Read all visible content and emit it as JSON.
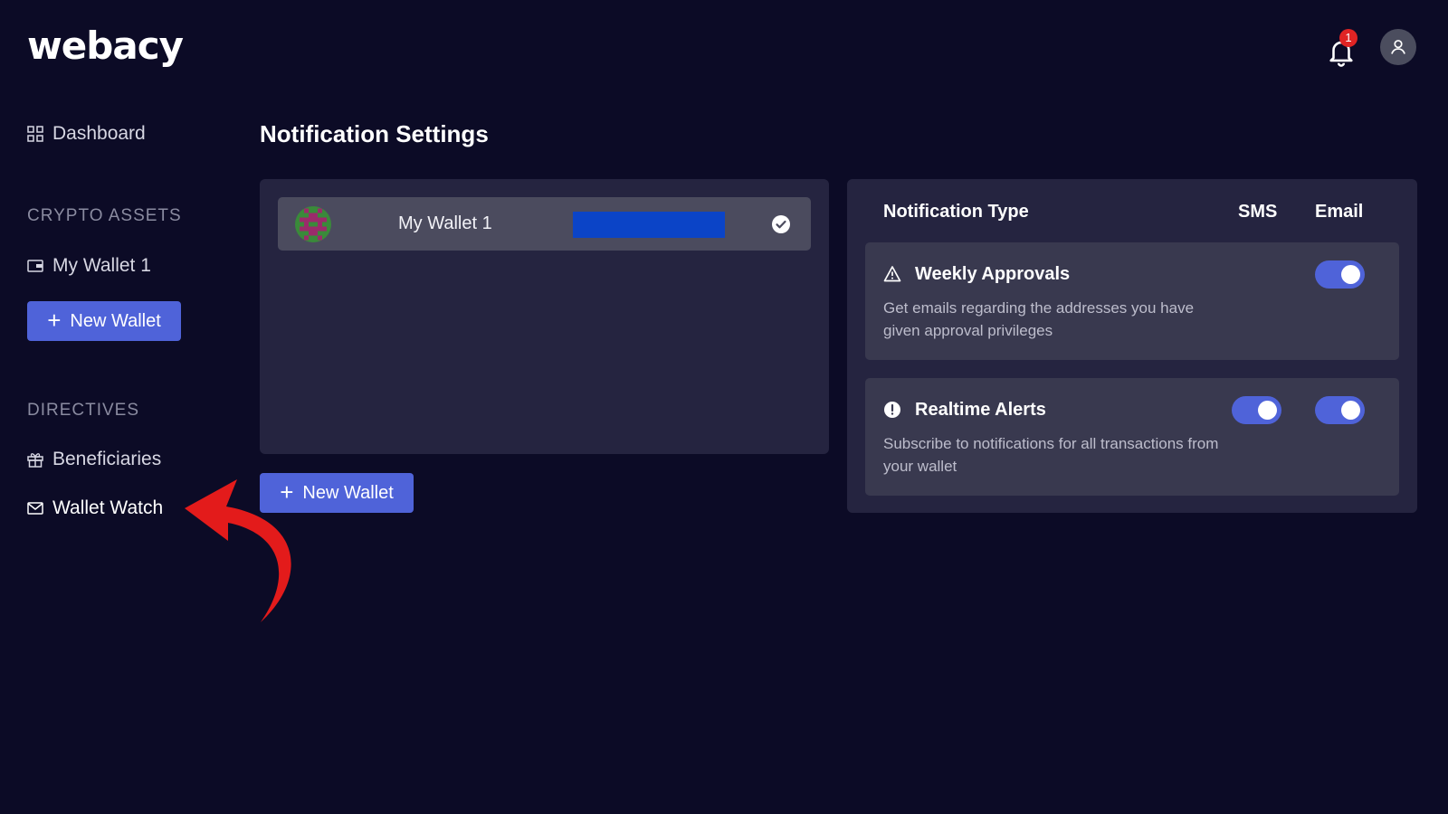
{
  "header": {
    "logo": "webacy",
    "notification_count": "1"
  },
  "sidebar": {
    "dashboard_label": "Dashboard",
    "crypto_assets_title": "CRYPTO ASSETS",
    "wallet_item_label": "My Wallet 1",
    "new_wallet_label": "New Wallet",
    "directives_title": "DIRECTIVES",
    "beneficiaries_label": "Beneficiaries",
    "wallet_watch_label": "Wallet Watch"
  },
  "main": {
    "title": "Notification Settings",
    "wallet": {
      "name": "My Wallet 1",
      "selected": true
    },
    "new_wallet_label": "New Wallet"
  },
  "notifications": {
    "columns": {
      "type": "Notification Type",
      "sms": "SMS",
      "email": "Email"
    },
    "items": [
      {
        "title": "Weekly Approvals",
        "description": "Get emails regarding the addresses you have given approval privileges",
        "sms_enabled": null,
        "email_enabled": true
      },
      {
        "title": "Realtime Alerts",
        "description": "Subscribe to notifications for all transactions from your wallet",
        "sms_enabled": true,
        "email_enabled": true
      }
    ]
  },
  "colors": {
    "background": "#0c0b26",
    "panel": "#252440",
    "card": "#39394f",
    "accent": "#4f63d9",
    "annotation_arrow": "#e31b1b"
  }
}
